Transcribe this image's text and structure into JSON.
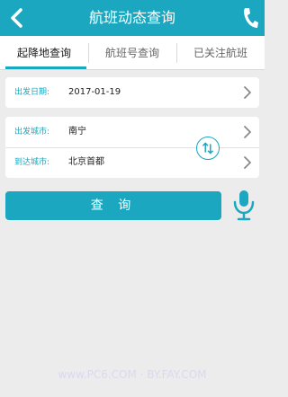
{
  "header": {
    "title": "航班动态查询",
    "back_icon": "chevron-left-icon",
    "phone_icon": "phone-icon",
    "background_color": "#1aa7bf"
  },
  "tabs": [
    {
      "label": "起降地查询",
      "active": true
    },
    {
      "label": "航班号查询",
      "active": false
    },
    {
      "label": "已关注航班",
      "active": false
    }
  ],
  "form": {
    "date_label": "出发日期:",
    "date_value": "2017-01-19",
    "departure_label": "出发城市:",
    "departure_value": "南宁",
    "arrival_label": "到达城市:",
    "arrival_value": "北京首都",
    "swap_icon": "swap-icon"
  },
  "actions": {
    "query_label": "查 询",
    "mic_icon": "microphone-icon"
  },
  "watermark": "www.PC6.COM  ·  BY.FAY.COM"
}
